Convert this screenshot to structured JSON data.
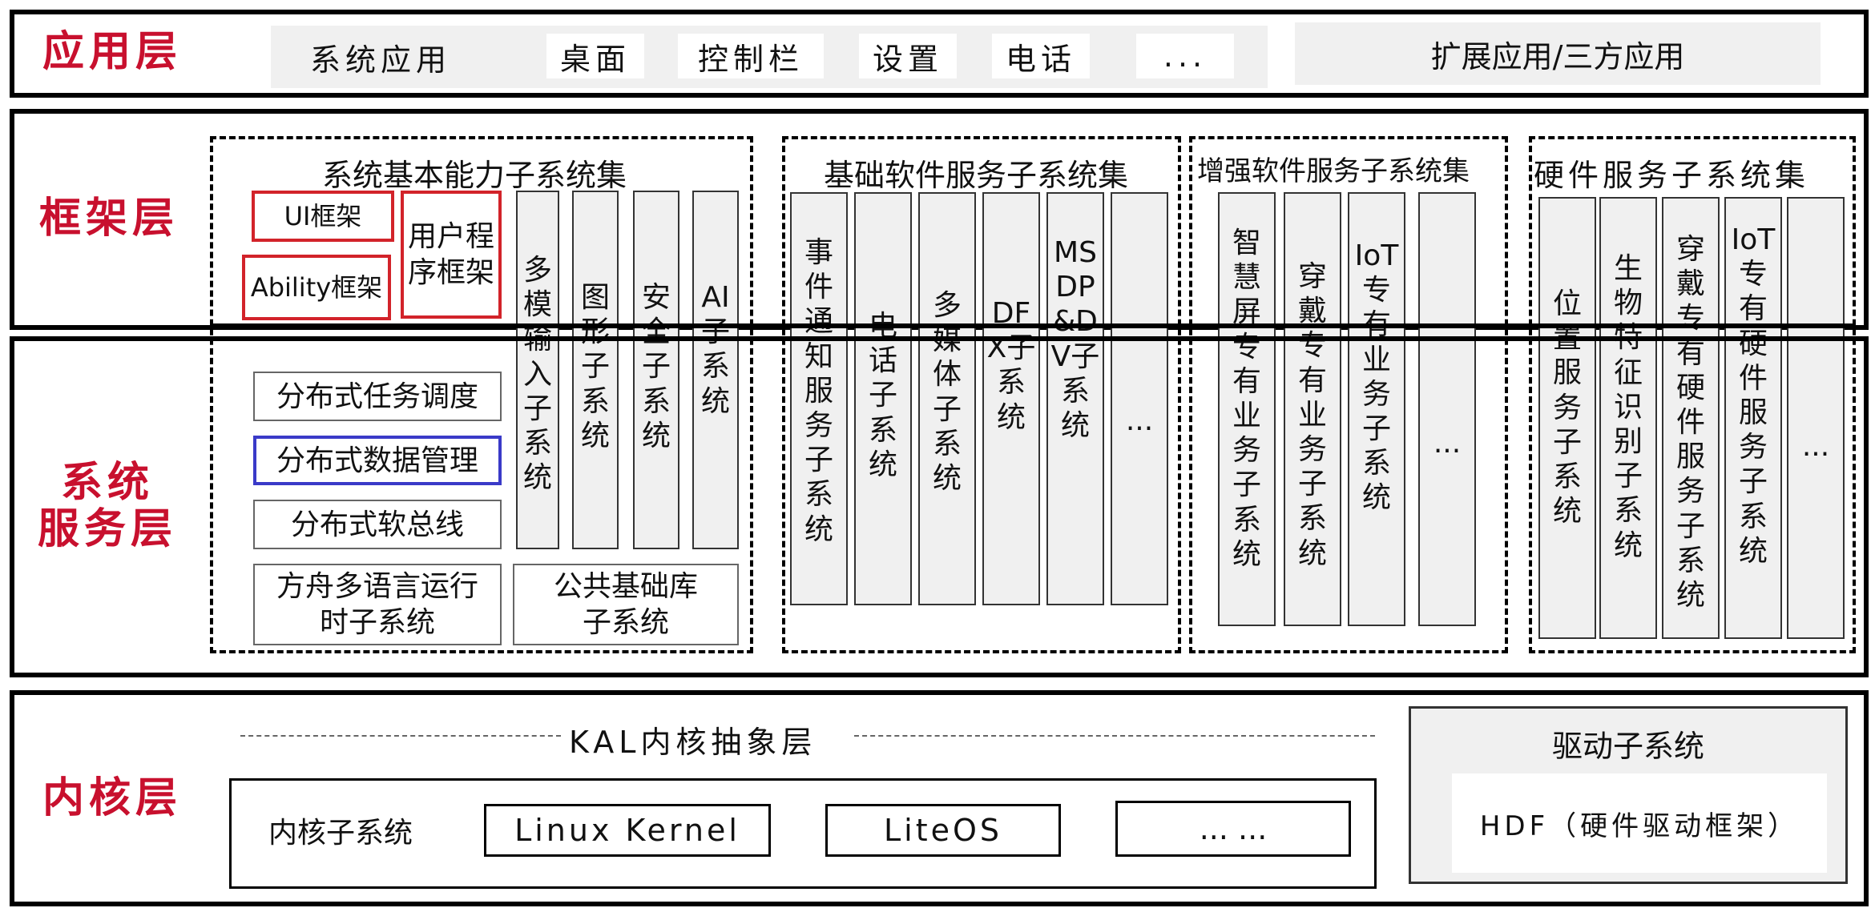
{
  "layers": {
    "app": "应用层",
    "framework": "框架层",
    "service": "系统\n服务层",
    "kernel": "内核层"
  },
  "app_layer": {
    "system_apps": "系统应用",
    "items": [
      "桌面",
      "控制栏",
      "设置",
      "电话",
      "..."
    ],
    "extension": "扩展应用/三方应用"
  },
  "basic_set": {
    "title": "系统基本能力子系统集",
    "ui_framework": "UI框架",
    "ability_framework": "Ability框架",
    "user_program_framework": "用户程\n序框架",
    "distributed": [
      "分布式任务调度",
      "分布式数据管理",
      "分布式软总线"
    ],
    "ark_runtime": "方舟多语言运行\n时子系统",
    "common_lib": "公共基础库\n子系统",
    "columns": [
      "多模输入子系统",
      "图形子系统",
      "安全子系统",
      "AI子系统"
    ]
  },
  "basic_software": {
    "title": "基础软件服务子系统集",
    "columns": [
      "事件通知服务子系统",
      "电话子系统",
      "多媒体子系统",
      "DFX子系统",
      "MSDP&DV子系统",
      "..."
    ]
  },
  "enhanced_software": {
    "title": "增强软件服务子系统集",
    "columns": [
      "智慧屏专有业务子系统",
      "穿戴专有业务子系统",
      "IoT专有业务子系统",
      "..."
    ]
  },
  "hardware_service": {
    "title": "硬件服务子系统集",
    "columns": [
      "位置服务子系统",
      "生物特征识别子系统",
      "穿戴专有硬件服务子系统",
      "IoT专有硬件服务子系统",
      "..."
    ]
  },
  "kernel_layer": {
    "kal": "KAL内核抽象层",
    "kernel_subsystem": "内核子系统",
    "kernels": [
      "Linux Kernel",
      "LiteOS",
      "... ..."
    ],
    "driver": "驱动子系统",
    "hdf": "HDF（硬件驱动框架）"
  }
}
